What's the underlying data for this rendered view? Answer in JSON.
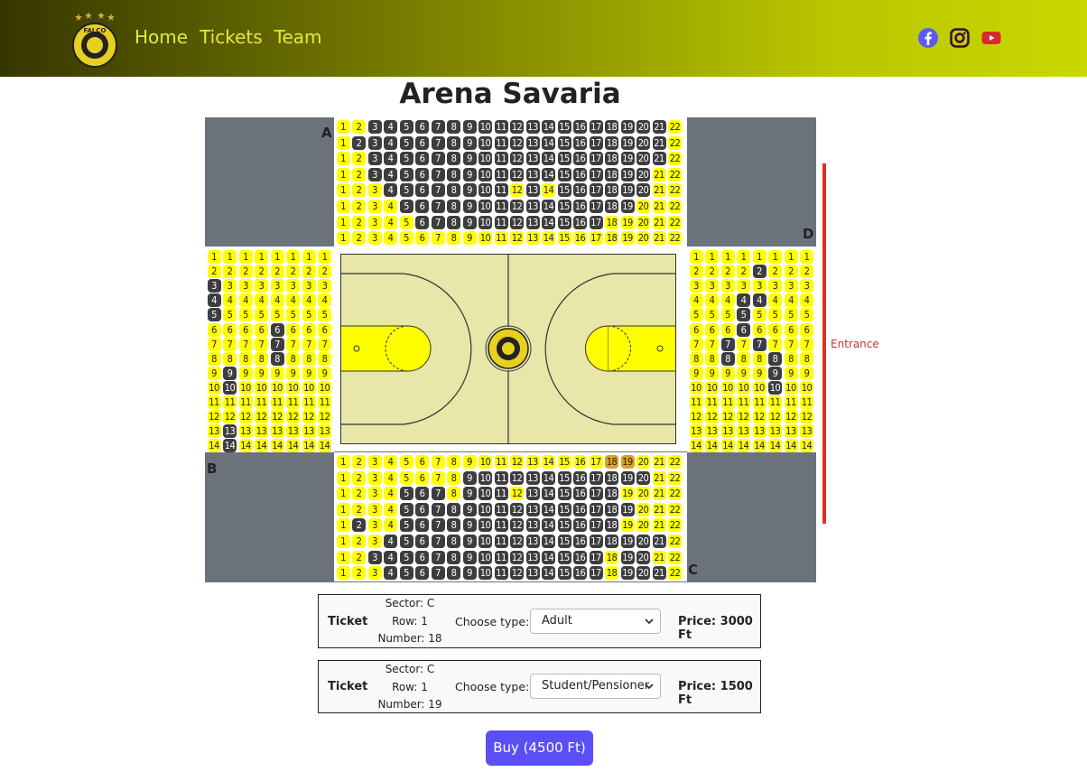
{
  "nav": {
    "links": [
      "Home",
      "Tickets",
      "Team"
    ],
    "social": [
      "facebook-icon",
      "instagram-icon",
      "youtube-icon"
    ],
    "logo": "FALCO",
    "colors": {
      "gradient_start": "#363600",
      "gradient_end": "#c9d800",
      "link": "#e2ea3a"
    }
  },
  "title": "Arena Savaria",
  "sectors": {
    "A": {
      "label": "A",
      "rows": 8,
      "seats_per_row": 22,
      "taken": {
        "1": [
          3,
          4,
          5,
          6,
          7,
          8,
          9,
          10,
          11,
          12,
          13,
          14,
          15,
          16,
          17,
          18,
          19,
          20,
          21
        ],
        "2": [
          2,
          3,
          4,
          5,
          6,
          7,
          8,
          9,
          10,
          11,
          12,
          13,
          14,
          15,
          16,
          17,
          18,
          19,
          20,
          21
        ],
        "3": [
          3,
          4,
          5,
          6,
          7,
          8,
          9,
          10,
          11,
          12,
          13,
          14,
          15,
          16,
          17,
          18,
          19,
          20,
          21
        ],
        "4": [
          3,
          4,
          5,
          6,
          7,
          8,
          9,
          10,
          11,
          12,
          13,
          14,
          15,
          16,
          17,
          18,
          19,
          20
        ],
        "5": [
          4,
          5,
          6,
          7,
          8,
          9,
          10,
          11,
          13,
          15,
          16,
          17,
          18,
          19,
          20
        ],
        "6": [
          5,
          6,
          7,
          8,
          9,
          10,
          11,
          12,
          13,
          14,
          15,
          16,
          17,
          18,
          19
        ],
        "7": [
          6,
          7,
          8,
          9,
          10,
          11,
          12,
          13,
          14,
          15,
          16,
          17
        ],
        "8": []
      }
    },
    "B": {
      "label": "B",
      "rows": 14,
      "seats_per_row": 8,
      "taken": {
        "3": [
          1
        ],
        "4": [
          1
        ],
        "5": [
          1
        ],
        "6": [
          5
        ],
        "7": [
          5
        ],
        "8": [
          5
        ],
        "9": [
          2
        ],
        "10": [
          2
        ],
        "13": [
          2
        ],
        "14": [
          2
        ]
      }
    },
    "C": {
      "label": "C",
      "rows": 8,
      "seats_per_row": 22,
      "selected": {
        "1": [
          18,
          19
        ]
      },
      "taken": {
        "1": [],
        "2": [
          9,
          10,
          11,
          12,
          13,
          14,
          15,
          16,
          17,
          18,
          19,
          20
        ],
        "3": [
          5,
          6,
          7,
          9,
          10,
          11,
          13,
          14,
          15,
          16,
          17,
          18
        ],
        "4": [
          5,
          6,
          7,
          8,
          9,
          10,
          11,
          12,
          13,
          14,
          15,
          16,
          17,
          18,
          19
        ],
        "5": [
          2,
          5,
          6,
          7,
          8,
          9,
          10,
          11,
          12,
          13,
          14,
          15,
          16,
          17,
          18
        ],
        "6": [
          4,
          5,
          6,
          7,
          8,
          9,
          10,
          11,
          12,
          13,
          14,
          15,
          16,
          17,
          18,
          19,
          20,
          21
        ],
        "7": [
          3,
          4,
          5,
          6,
          7,
          8,
          9,
          10,
          11,
          12,
          13,
          14,
          15,
          16,
          17,
          19,
          20
        ],
        "8": [
          4,
          5,
          6,
          7,
          8,
          9,
          10,
          11,
          12,
          13,
          14,
          15,
          16,
          17,
          19,
          20,
          21
        ]
      }
    },
    "D": {
      "label": "D",
      "rows": 14,
      "seats_per_row": 8,
      "taken": {
        "2": [
          5
        ],
        "4": [
          4,
          5
        ],
        "5": [
          4
        ],
        "6": [
          4
        ],
        "7": [
          3,
          5
        ],
        "8": [
          3,
          6
        ],
        "9": [
          6
        ],
        "10": [
          6
        ]
      }
    }
  },
  "entrance": "Entrance",
  "tickets": [
    {
      "label": "Ticket",
      "sector": "Sector: C",
      "row": "Row: 1",
      "number": "Number: 18",
      "choose": "Choose type:",
      "type": "Adult",
      "price": "Price: 3000 Ft"
    },
    {
      "label": "Ticket",
      "sector": "Sector: C",
      "row": "Row: 1",
      "number": "Number: 19",
      "choose": "Choose type:",
      "type": "Student/Pensioner",
      "price": "Price: 1500 Ft"
    }
  ],
  "buy_label": "Buy (4500 Ft)"
}
